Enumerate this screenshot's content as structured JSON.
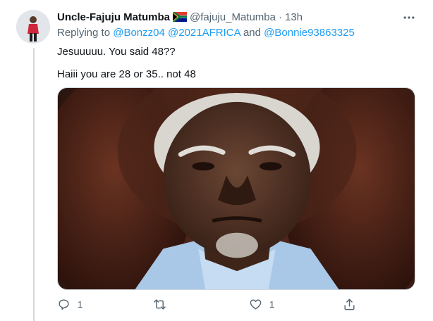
{
  "tweet": {
    "author_name": "Uncle-Fajuju Matumba",
    "handle": "@fajuju_Matumba",
    "separator": "·",
    "time": "13h",
    "replying_prefix": "Replying to",
    "mentions": [
      "@Bonzz04",
      "@2021AFRICA",
      "@Bonnie93863325"
    ],
    "connector": "and",
    "text_line1": "Jesuuuuu. You said 48??",
    "text_line2": "Haiii you are 28 or 35.. not 48"
  },
  "actions": {
    "reply_count": "1",
    "retweet_count": "",
    "like_count": "1"
  },
  "icons": {
    "flag": "south-africa-flag-icon",
    "more": "more-icon",
    "reply": "reply-icon",
    "retweet": "retweet-icon",
    "like": "like-icon",
    "share": "share-icon"
  },
  "colors": {
    "link": "#1d9bf0",
    "secondary_text": "#536471",
    "primary_text": "#0f1419"
  }
}
